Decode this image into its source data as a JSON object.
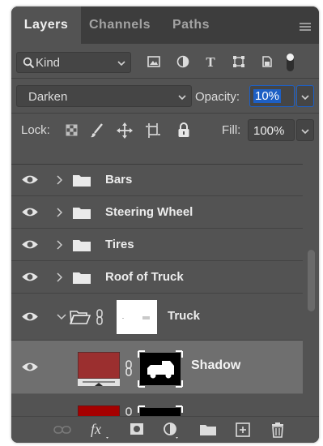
{
  "tabs": [
    "Layers",
    "Channels",
    "Paths"
  ],
  "filter": {
    "label": "Kind"
  },
  "blend": {
    "mode": "Darken",
    "opacity_label": "Opacity:",
    "opacity_value": "10%"
  },
  "lock": {
    "label": "Lock:",
    "fill_label": "Fill:",
    "fill_value": "100%"
  },
  "layers": [
    {
      "name": "Bars"
    },
    {
      "name": "Steering Wheel"
    },
    {
      "name": "Tires"
    },
    {
      "name": "Roof of Truck"
    },
    {
      "name": "Truck"
    },
    {
      "name": "Shadow"
    }
  ],
  "colors": {
    "panel": "#535353",
    "tabbar": "#3d3d3d",
    "selected_layer": "#6f6f6f",
    "highlight": "#1d5fc4",
    "shadow_swatch": "#9b2f2f",
    "red_swatch": "#a50000"
  }
}
